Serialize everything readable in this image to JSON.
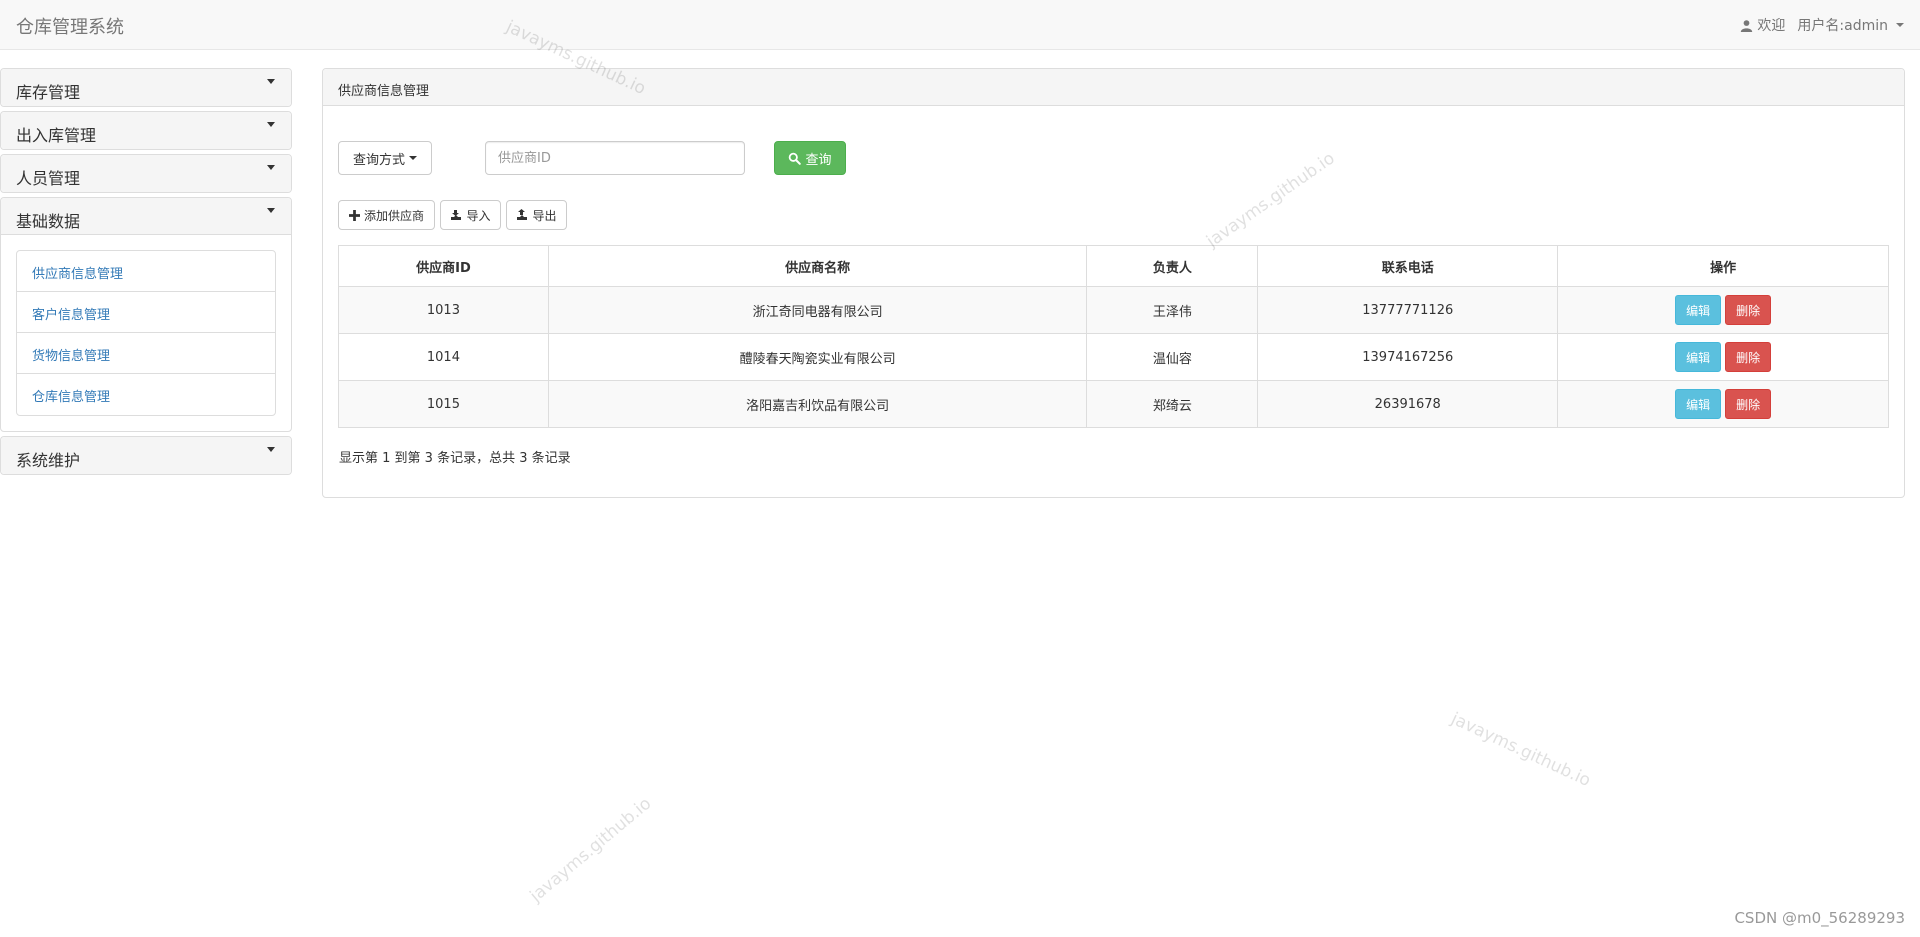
{
  "navbar": {
    "brand": "仓库管理系统",
    "welcome": "欢迎",
    "username": "用户名:admin"
  },
  "sidebar": {
    "sections": [
      {
        "label": "库存管理"
      },
      {
        "label": "出入库管理"
      },
      {
        "label": "人员管理"
      },
      {
        "label": "基础数据",
        "expanded": true,
        "items": [
          {
            "label": "供应商信息管理"
          },
          {
            "label": "客户信息管理"
          },
          {
            "label": "货物信息管理"
          },
          {
            "label": "仓库信息管理"
          }
        ]
      },
      {
        "label": "系统维护"
      }
    ]
  },
  "main": {
    "panel_title": "供应商信息管理",
    "query_mode_label": "查询方式",
    "search_placeholder": "供应商ID",
    "search_button": "查询",
    "add_button": "添加供应商",
    "import_button": "导入",
    "export_button": "导出",
    "table": {
      "headers": [
        "供应商ID",
        "供应商名称",
        "负责人",
        "联系电话",
        "操作"
      ],
      "rows": [
        {
          "id": "1013",
          "name": "浙江奇同电器有限公司",
          "person": "王泽伟",
          "phone": "13777771126"
        },
        {
          "id": "1014",
          "name": "醴陵春天陶瓷实业有限公司",
          "person": "温仙容",
          "phone": "13974167256"
        },
        {
          "id": "1015",
          "name": "洛阳嘉吉利饮品有限公司",
          "person": "郑绮云",
          "phone": "26391678"
        }
      ],
      "edit_label": "编辑",
      "delete_label": "删除"
    },
    "pager_text": "显示第 1 到第 3 条记录，总共 3 条记录"
  },
  "watermark_text": "javayms.github.io",
  "credit": "CSDN @m0_56289293",
  "colors": {
    "success": "#5cb85c",
    "info": "#5bc0de",
    "danger": "#d9534f",
    "link": "#337ab7"
  }
}
